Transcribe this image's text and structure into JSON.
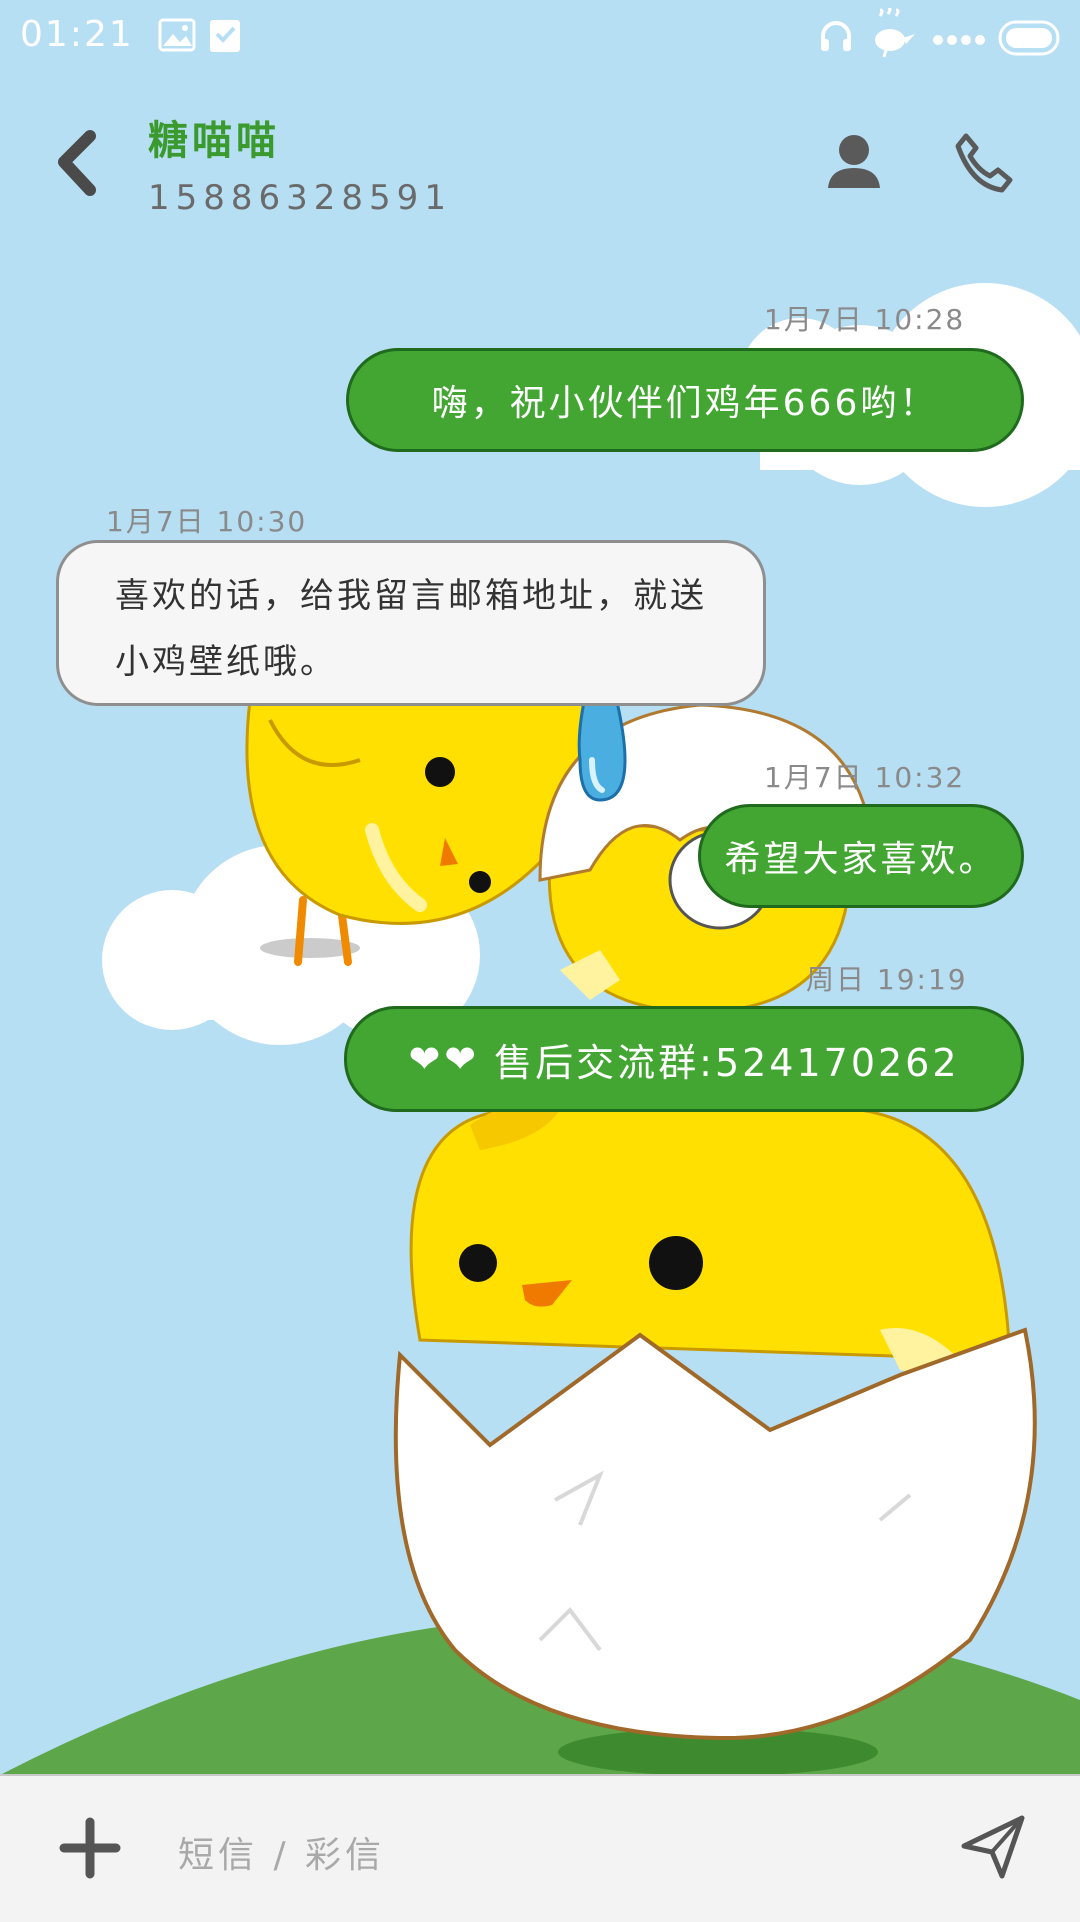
{
  "status_bar": {
    "time": "01:21",
    "icons": [
      "image-icon",
      "check-shield-icon",
      "headphones-icon",
      "bird-icon",
      "signal-dots-icon",
      "battery-icon"
    ]
  },
  "header": {
    "back_icon": "back-chevron-icon",
    "contact_name": "糖喵喵",
    "contact_number": "15886328591",
    "contact_icon": "contact-person-icon",
    "call_icon": "phone-icon"
  },
  "messages": [
    {
      "direction": "out",
      "timestamp": "1月7日 10:28",
      "text": "嗨，祝小伙伴们鸡年666哟！"
    },
    {
      "direction": "in",
      "timestamp": "1月7日 10:30",
      "text": "喜欢的话，给我留言邮箱地址，就送小鸡壁纸哦。"
    },
    {
      "direction": "out",
      "timestamp": "1月7日 10:32",
      "text": "希望大家喜欢。"
    },
    {
      "direction": "out",
      "timestamp": "周日 19:19",
      "hearts": "❤❤",
      "text": "售后交流群:524170262"
    }
  ],
  "composer": {
    "add_icon": "plus-icon",
    "placeholder": "短信 / 彩信",
    "send_icon": "send-arrow-icon"
  },
  "colors": {
    "background": "#b7dff4",
    "outgoing_bubble": "#43a633",
    "incoming_bubble": "#f6f6f6",
    "contact_name": "#3a9a2e",
    "chick_yellow": "#ffe000",
    "grass": "#5da64a"
  }
}
